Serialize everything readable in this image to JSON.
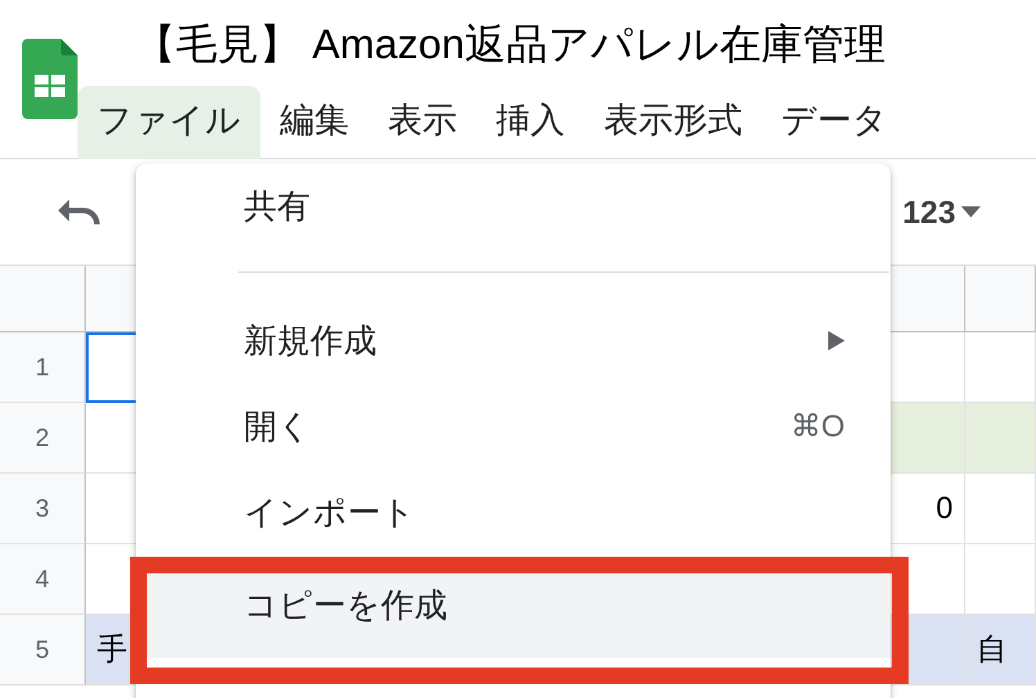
{
  "app": {
    "title": "【毛見】 Amazon返品アパレル在庫管理"
  },
  "menubar": [
    {
      "label": "ファイル",
      "selected": true
    },
    {
      "label": "編集",
      "selected": false
    },
    {
      "label": "表示",
      "selected": false
    },
    {
      "label": "挿入",
      "selected": false
    },
    {
      "label": "表示形式",
      "selected": false
    },
    {
      "label": "データ",
      "selected": false
    }
  ],
  "toolbar": {
    "number_format": "123"
  },
  "rows": [
    {
      "header": "1",
      "cells": [
        {
          "text": "",
          "selected": true
        },
        {
          "text": "",
          "selected": false
        },
        {
          "text": "",
          "selected": false
        }
      ]
    },
    {
      "header": "2",
      "cells": [
        {
          "text": "",
          "selected": false
        },
        {
          "text": "",
          "selected": false,
          "color": "#e6efde"
        },
        {
          "text": "",
          "selected": false,
          "color": "#e6efde"
        }
      ]
    },
    {
      "header": "3",
      "cells": [
        {
          "text": "",
          "selected": false
        },
        {
          "text": "0",
          "selected": false
        },
        {
          "text": "",
          "selected": false
        }
      ]
    },
    {
      "header": "4",
      "cells": [
        {
          "text": "",
          "selected": false
        },
        {
          "text": "",
          "selected": false
        },
        {
          "text": "",
          "selected": false
        }
      ]
    },
    {
      "header": "5",
      "cells": [
        {
          "text": "手",
          "selected": false,
          "color": "#d9e1f2"
        },
        {
          "text": "",
          "selected": false,
          "color": "#d9e1f2"
        },
        {
          "text": "自",
          "selected": false,
          "color": "#d9e1f2"
        }
      ]
    }
  ],
  "file_menu": {
    "items": [
      {
        "kind": "item",
        "label": "共有",
        "highlighted": false
      },
      {
        "kind": "divider"
      },
      {
        "kind": "submenu",
        "label": "新規作成",
        "highlighted": false
      },
      {
        "kind": "item",
        "label": "開く",
        "shortcut": "⌘O",
        "highlighted": false
      },
      {
        "kind": "item",
        "label": "インポート",
        "highlighted": false
      },
      {
        "kind": "item",
        "label": "コピーを作成",
        "highlighted": true
      }
    ]
  }
}
